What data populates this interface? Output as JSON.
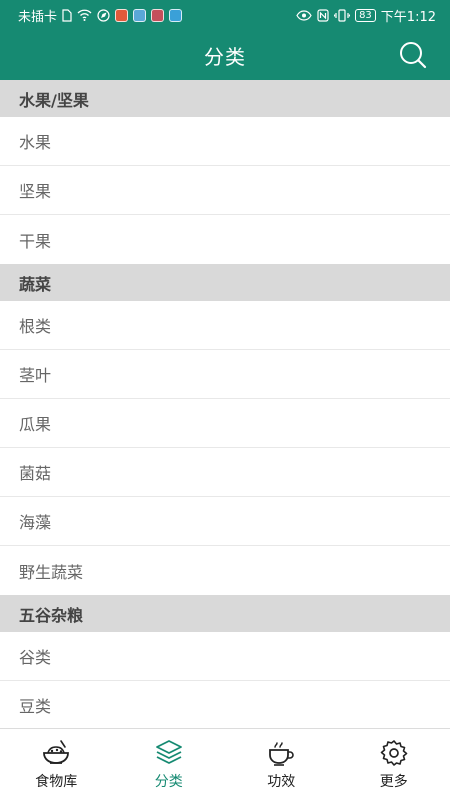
{
  "status_bar": {
    "carrier": "未插卡",
    "battery": "83",
    "time": "下午1:12"
  },
  "header": {
    "title": "分类"
  },
  "sections": [
    {
      "title": "水果/坚果",
      "items": [
        "水果",
        "坚果",
        "干果"
      ]
    },
    {
      "title": "蔬菜",
      "items": [
        "根类",
        "茎叶",
        "瓜果",
        "菌菇",
        "海藻",
        "野生蔬菜"
      ]
    },
    {
      "title": "五谷杂粮",
      "items": [
        "谷类",
        "豆类"
      ]
    }
  ],
  "tabs": [
    {
      "label": "食物库",
      "icon": "food-bowl-icon"
    },
    {
      "label": "分类",
      "icon": "layers-icon",
      "active": true
    },
    {
      "label": "功效",
      "icon": "teacup-icon"
    },
    {
      "label": "更多",
      "icon": "gear-icon"
    }
  ],
  "colors": {
    "primary": "#168a72",
    "section_bg": "#d9d9d9"
  }
}
